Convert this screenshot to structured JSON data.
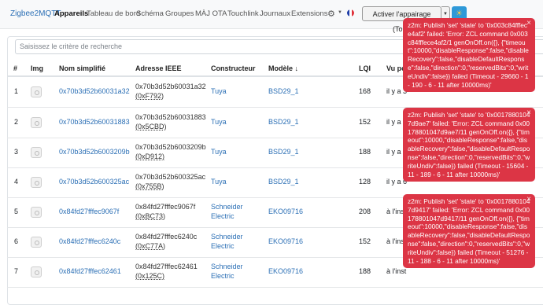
{
  "nav": {
    "brand": "Zigbee2MQTT",
    "links": [
      "Appareils",
      "Tableau de bord",
      "Schéma",
      "Groupes",
      "MÀJ OTA",
      "Touchlink",
      "Journaux",
      "Extensions"
    ],
    "active_index": 0,
    "pair_button": "Activer l'appairage (Tout)"
  },
  "search": {
    "placeholder": "Saisissez le critère de recherche"
  },
  "table": {
    "headers": [
      "#",
      "Img",
      "Nom simplifié",
      "Adresse IEEE",
      "Constructeur",
      "Modèle ↓",
      "LQI",
      "Vu po"
    ],
    "rows": [
      {
        "num": "1",
        "name": "0x70b3d52b60031a32",
        "ieee": "0x70b3d52b60031a32",
        "nwk": "(0xF792)",
        "vendor": "Tuya",
        "model": "BSD29_1",
        "lqi": "168",
        "seen": "il y a 3"
      },
      {
        "num": "2",
        "name": "0x70b3d52b60031883",
        "ieee": "0x70b3d52b60031883",
        "nwk": "(0x5CBD)",
        "vendor": "Tuya",
        "model": "BSD29_1",
        "lqi": "152",
        "seen": "il y a 1"
      },
      {
        "num": "3",
        "name": "0x70b3d52b6003209b",
        "ieee": "0x70b3d52b6003209b",
        "nwk": "(0xD912)",
        "vendor": "Tuya",
        "model": "BSD29_1",
        "lqi": "188",
        "seen": "il y a 1"
      },
      {
        "num": "4",
        "name": "0x70b3d52b600325ac",
        "ieee": "0x70b3d52b600325ac",
        "nwk": "(0x755B)",
        "vendor": "Tuya",
        "model": "BSD29_1",
        "lqi": "128",
        "seen": "il y a 6"
      },
      {
        "num": "5",
        "name": "0x84fd27fffec9067f",
        "ieee": "0x84fd27fffec9067f",
        "nwk": "(0xBC73)",
        "vendor": "Schneider Electric",
        "vendor1": "Schneider",
        "vendor2": "Electric",
        "model": "EKO09716",
        "lqi": "208",
        "seen": "à l'inst"
      },
      {
        "num": "6",
        "name": "0x84fd27fffec6240c",
        "ieee": "0x84fd27fffec6240c",
        "nwk": "(0xC77A)",
        "vendor": "Schneider Electric",
        "vendor1": "Schneider",
        "vendor2": "Electric",
        "model": "EKO09716",
        "lqi": "152",
        "seen": "à l'inst"
      },
      {
        "num": "7",
        "name": "0x84fd27fffec62461",
        "ieee": "0x84fd27fffec62461",
        "nwk": "(0x125C)",
        "vendor": "Schneider Electric",
        "vendor1": "Schneider",
        "vendor2": "Electric",
        "model": "EKO09716",
        "lqi": "188",
        "seen": "à l'inst"
      }
    ]
  },
  "toasts": [
    {
      "text": "z2m: Publish 'set' 'state' to '0x003c84fffece4af2' failed: 'Error: ZCL command 0x003c84fffece4af2/1 genOnOff.on({}, {\"timeout\":10000,\"disableResponse\":false,\"disableRecovery\":false,\"disableDefaultResponse\":false,\"direction\":0,\"reservedBits\":0,\"writeUndiv\":false}) failed (Timeout - 29660 - 1 - 190 - 6 - 11 after 10000ms)'"
    },
    {
      "text": "z2m: Publish 'set' 'state' to '0x00178801047d9ae7' failed: 'Error: ZCL command 0x00178801047d9ae7/11 genOnOff.on({}, {\"timeout\":10000,\"disableResponse\":false,\"disableRecovery\":false,\"disableDefaultResponse\":false,\"direction\":0,\"reservedBits\":0,\"writeUndiv\":false}) failed (Timeout - 15604 - 11 - 189 - 6 - 11 after 10000ms)'"
    },
    {
      "text": "z2m: Publish 'set' 'state' to '0x00178801047d9417' failed: 'Error: ZCL command 0x00178801047d9417/11 genOnOff.on({}, {\"timeout\":10000,\"disableResponse\":false,\"disableRecovery\":false,\"disableDefaultResponse\":false,\"direction\":0,\"reservedBits\":0,\"writeUndiv\":false}) failed (Timeout - 51276 - 11 - 188 - 6 - 11 after 10000ms)'"
    }
  ],
  "colors": {
    "link": "#2b6fb5",
    "toast": "#dc3545",
    "navbar": "#f8f9fa",
    "flag": [
      "#1f3ea8",
      "#ffffff",
      "#e0323a"
    ]
  },
  "icons": [
    "gear-icon",
    "france-flag-icon",
    "sun-icon",
    "caret-down-icon",
    "sort-icon",
    "device-image-icon",
    "close-icon"
  ]
}
